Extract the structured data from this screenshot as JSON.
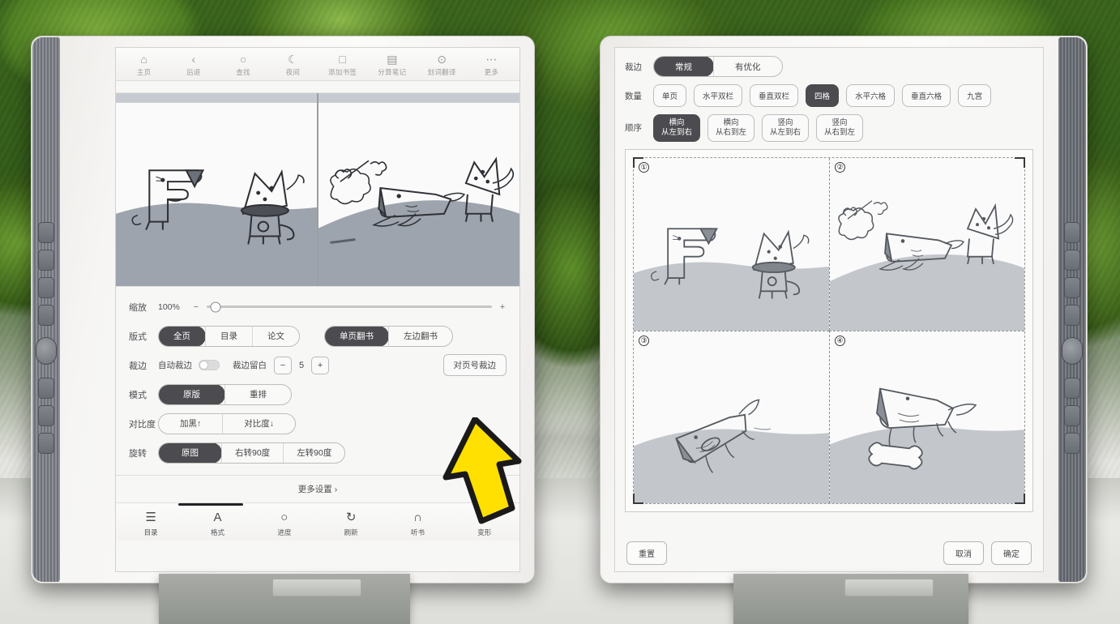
{
  "scene": {
    "description": "Two e-ink reader tablets photographed side by side in front of green plant leaves on a light desk",
    "cursor": "yellow-arrow-pointer"
  },
  "left_device": {
    "top_toolbar": [
      {
        "icon": "home-icon",
        "glyph": "⌂",
        "label": "主页"
      },
      {
        "icon": "back-icon",
        "glyph": "‹",
        "label": "后退"
      },
      {
        "icon": "search-icon",
        "glyph": "○",
        "label": "查找"
      },
      {
        "icon": "moon-icon",
        "glyph": "☾",
        "label": "夜间"
      },
      {
        "icon": "bookmark-icon",
        "glyph": "□",
        "label": "添加书签"
      },
      {
        "icon": "note-icon",
        "glyph": "▤",
        "label": "分算笔记"
      },
      {
        "icon": "translate-icon",
        "glyph": "⊙",
        "label": "划词翻译"
      },
      {
        "icon": "more-icon",
        "glyph": "⋯",
        "label": "更多"
      }
    ],
    "preview": {
      "left_page_alt": "狗和猫的简笔画，左页",
      "right_page_alt": "狗追骨头的简笔画，右页"
    },
    "settings": {
      "zoom": {
        "label": "缩放",
        "value": "100%",
        "minus": "−",
        "plus": "+",
        "percent": 3
      },
      "layout": {
        "label": "版式",
        "options": [
          {
            "text": "全页",
            "selected": true
          },
          {
            "text": "目录",
            "selected": false
          },
          {
            "text": "论文",
            "selected": false
          }
        ],
        "page_mode": [
          {
            "text": "单页翻书",
            "selected": true
          },
          {
            "text": "左边翻书",
            "selected": false
          }
        ]
      },
      "crop": {
        "label": "裁边",
        "auto_label": "自动裁边",
        "auto_on": false,
        "margin_label": "裁边留白",
        "margin_minus": "−",
        "margin_value": "5",
        "margin_plus": "+",
        "page_crop_button": "对页号裁边"
      },
      "mode": {
        "label": "模式",
        "options": [
          {
            "text": "原版",
            "selected": true
          },
          {
            "text": "重排",
            "selected": false
          }
        ]
      },
      "contrast": {
        "label": "对比度",
        "options": [
          {
            "text": "加黑↑",
            "selected": false
          },
          {
            "text": "对比度↓",
            "selected": false
          }
        ]
      },
      "rotate": {
        "label": "旋转",
        "options": [
          {
            "text": "原图",
            "selected": true
          },
          {
            "text": "右转90度",
            "selected": false
          },
          {
            "text": "左转90度",
            "selected": false
          }
        ]
      },
      "more_settings": "更多设置 ›"
    },
    "bottom_nav": [
      {
        "icon": "list-icon",
        "glyph": "☰",
        "label": "目录",
        "active": false
      },
      {
        "icon": "font-icon",
        "glyph": "A",
        "label": "格式",
        "active": true
      },
      {
        "icon": "progress-icon",
        "glyph": "○",
        "label": "进度",
        "active": false
      },
      {
        "icon": "refresh-icon",
        "glyph": "↻",
        "label": "刷新",
        "active": false
      },
      {
        "icon": "headphone-icon",
        "glyph": "∩",
        "label": "听书",
        "active": false
      },
      {
        "icon": "crop-icon",
        "glyph": "⌗",
        "label": "变形",
        "active": false
      }
    ]
  },
  "right_device": {
    "crop_panel": {
      "crop": {
        "label": "裁边",
        "options": [
          {
            "text": "常规",
            "selected": true
          },
          {
            "text": "有优化",
            "selected": false
          }
        ]
      },
      "count": {
        "label": "数量",
        "options": [
          {
            "text": "单页",
            "selected": false
          },
          {
            "text": "水平双栏",
            "selected": false
          },
          {
            "text": "垂直双栏",
            "selected": false
          },
          {
            "text": "四格",
            "selected": true
          },
          {
            "text": "水平六格",
            "selected": false
          },
          {
            "text": "垂直六格",
            "selected": false
          },
          {
            "text": "九宫",
            "selected": false
          }
        ]
      },
      "order": {
        "label": "顺序",
        "options": [
          {
            "line1": "横向",
            "line2": "从左到右",
            "selected": true
          },
          {
            "line1": "横向",
            "line2": "从右到左",
            "selected": false
          },
          {
            "line1": "竖向",
            "line2": "从左到右",
            "selected": false
          },
          {
            "line1": "竖向",
            "line2": "从右到左",
            "selected": false
          }
        ]
      }
    },
    "grid_preview": {
      "cells": [
        {
          "badge": "①",
          "alt": "狗和猫对视"
        },
        {
          "badge": "②",
          "alt": "骨头飞出，狗跟随"
        },
        {
          "badge": "③",
          "alt": "狗向上跳跃"
        },
        {
          "badge": "④",
          "alt": "狗在骨头旁"
        }
      ]
    },
    "footer": {
      "reset": "重置",
      "cancel": "取消",
      "confirm": "确定"
    }
  },
  "colors": {
    "accent_dark": "#4c4c50",
    "screen_bg": "#f7f7f6",
    "cursor_yellow": "#ffe000",
    "cursor_outline": "#1a1a1a"
  }
}
